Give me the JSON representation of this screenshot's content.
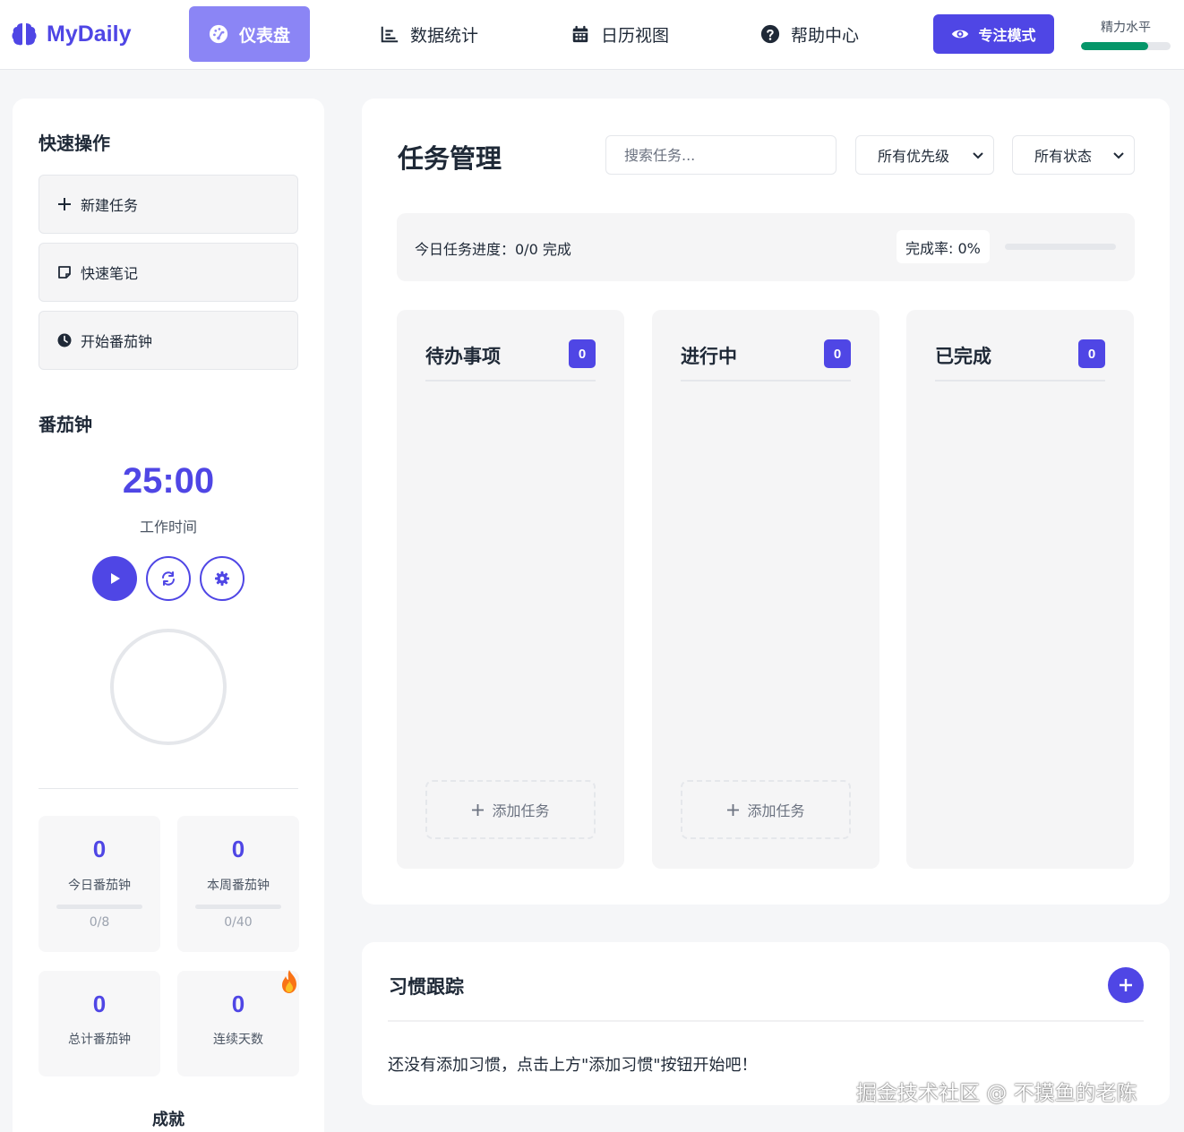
{
  "app": {
    "name": "MyDaily",
    "accent": "#4f46e5"
  },
  "nav": {
    "items": [
      {
        "label": "仪表盘",
        "icon": "dashboard-gauge-icon",
        "active": true
      },
      {
        "label": "数据统计",
        "icon": "bar-chart-icon"
      },
      {
        "label": "日历视图",
        "icon": "calendar-icon"
      },
      {
        "label": "帮助中心",
        "icon": "question-circle-icon"
      }
    ],
    "focus_button": "专注模式",
    "energy": {
      "label": "精力水平",
      "level_percent": 75,
      "color": "#059669"
    }
  },
  "sidebar": {
    "quick_actions_title": "快速操作",
    "quick_actions": [
      {
        "label": "新建任务",
        "icon": "plus-icon"
      },
      {
        "label": "快速笔记",
        "icon": "note-icon"
      },
      {
        "label": "开始番茄钟",
        "icon": "clock-icon"
      }
    ],
    "pomodoro_title": "番茄钟",
    "timer": "25:00",
    "timer_mode": "工作时间",
    "stats": [
      {
        "value": "0",
        "label": "今日番茄钟",
        "sub": "0/8"
      },
      {
        "value": "0",
        "label": "本周番茄钟",
        "sub": "0/40"
      },
      {
        "value": "0",
        "label": "总计番茄钟"
      },
      {
        "value": "0",
        "label": "连续天数",
        "icon": "fire-icon"
      }
    ],
    "achievements_title": "成就"
  },
  "tasks": {
    "title": "任务管理",
    "search_placeholder": "搜索任务...",
    "priority_filter": "所有优先级",
    "status_filter": "所有状态",
    "progress_text": "今日任务进度：0/0 完成",
    "completion_rate": "完成率: 0%",
    "completion_percent": 0,
    "columns": [
      {
        "title": "待办事项",
        "count": "0",
        "add_label": "添加任务"
      },
      {
        "title": "进行中",
        "count": "0",
        "add_label": "添加任务"
      },
      {
        "title": "已完成",
        "count": "0"
      }
    ]
  },
  "habits": {
    "title": "习惯跟踪",
    "empty_text": "还没有添加习惯，点击上方\"添加习惯\"按钮开始吧！"
  },
  "watermark": "掘金技术社区 @ 不摸鱼的老陈"
}
